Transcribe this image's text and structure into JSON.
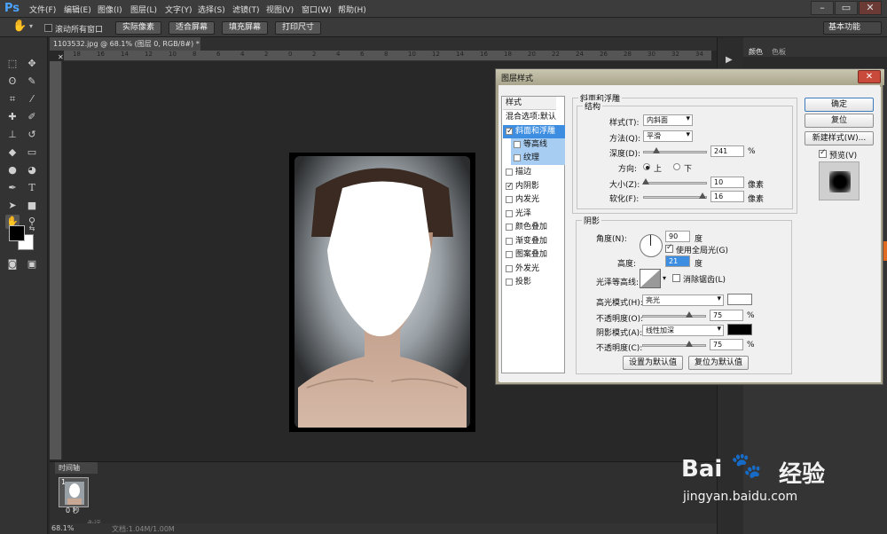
{
  "app": {
    "logo": "Ps"
  },
  "menu": [
    "文件(F)",
    "编辑(E)",
    "图像(I)",
    "图层(L)",
    "文字(Y)",
    "选择(S)",
    "滤镜(T)",
    "视图(V)",
    "窗口(W)",
    "帮助(H)"
  ],
  "window_controls": {
    "minimize": "–",
    "restore": "▭",
    "close": "✕"
  },
  "options_bar": {
    "scroll_all_label": "滚动所有窗口",
    "buttons": [
      "实际像素",
      "适合屏幕",
      "填充屏幕",
      "打印尺寸"
    ],
    "workspace": "基本功能"
  },
  "document": {
    "tab_title": "1103532.jpg @ 68.1% (图层 0, RGB/8#) *",
    "zoom": "68.1%",
    "status": "文档:1.04M/1.00M"
  },
  "ruler_ticks": [
    "18",
    "16",
    "14",
    "12",
    "10",
    "8",
    "6",
    "4",
    "2",
    "0",
    "2",
    "4",
    "6",
    "8",
    "10",
    "12",
    "14",
    "16",
    "18",
    "20",
    "22",
    "24",
    "26",
    "28",
    "30",
    "32",
    "34"
  ],
  "right_panel": {
    "tabs": [
      "颜色",
      "色板"
    ]
  },
  "timeline": {
    "tab": "时间轴",
    "frame_number": "1",
    "frame_time": "0 秒",
    "loop": "永远"
  },
  "watermark": {
    "brand": "Bai",
    "brand_cn": "经验",
    "url": "jingyan.baidu.com"
  },
  "dialog": {
    "title": "图层样式",
    "close": "✕",
    "styles_header": "样式",
    "style_items": [
      {
        "label": "混合选项:默认",
        "checkbox": false,
        "checked": false
      },
      {
        "label": "斜面和浮雕",
        "checkbox": true,
        "checked": true
      },
      {
        "label": "等高线",
        "checkbox": true,
        "checked": false
      },
      {
        "label": "纹理",
        "checkbox": true,
        "checked": false
      },
      {
        "label": "描边",
        "checkbox": true,
        "checked": false
      },
      {
        "label": "内阴影",
        "checkbox": true,
        "checked": true
      },
      {
        "label": "内发光",
        "checkbox": true,
        "checked": false
      },
      {
        "label": "光泽",
        "checkbox": true,
        "checked": false
      },
      {
        "label": "颜色叠加",
        "checkbox": true,
        "checked": false
      },
      {
        "label": "渐变叠加",
        "checkbox": true,
        "checked": false
      },
      {
        "label": "图案叠加",
        "checkbox": true,
        "checked": false
      },
      {
        "label": "外发光",
        "checkbox": true,
        "checked": false
      },
      {
        "label": "投影",
        "checkbox": true,
        "checked": false
      }
    ],
    "bevel": {
      "section_title": "斜面和浮雕",
      "structure_title": "结构",
      "style_label": "样式(T):",
      "style_value": "内斜面",
      "technique_label": "方法(Q):",
      "technique_value": "平滑",
      "depth_label": "深度(D):",
      "depth_value": "241",
      "depth_unit": "%",
      "direction_label": "方向:",
      "direction_up": "上",
      "direction_down": "下",
      "size_label": "大小(Z):",
      "size_value": "10",
      "size_unit": "像素",
      "soften_label": "软化(F):",
      "soften_value": "16",
      "soften_unit": "像素"
    },
    "shading": {
      "title": "阴影",
      "angle_label": "角度(N):",
      "angle_value": "90",
      "angle_unit": "度",
      "global_light_label": "使用全局光(G)",
      "altitude_label": "高度:",
      "altitude_value": "21",
      "altitude_unit": "度",
      "gloss_label": "光泽等高线:",
      "antialias_label": "消除锯齿(L)",
      "highlight_label": "高光模式(H):",
      "highlight_value": "亮光",
      "highlight_color": "#ffffff",
      "highlight_opacity_label": "不透明度(O):",
      "highlight_opacity": "75",
      "highlight_opacity_unit": "%",
      "shadow_label": "阴影模式(A):",
      "shadow_value": "线性加深",
      "shadow_color": "#000000",
      "shadow_opacity_label": "不透明度(C):",
      "shadow_opacity": "75",
      "shadow_opacity_unit": "%"
    },
    "buttons": {
      "ok": "确定",
      "reset": "复位",
      "new_style": "新建样式(W)...",
      "preview": "预览(V)",
      "make_default": "设置为默认值",
      "reset_default": "复位为默认值"
    }
  }
}
